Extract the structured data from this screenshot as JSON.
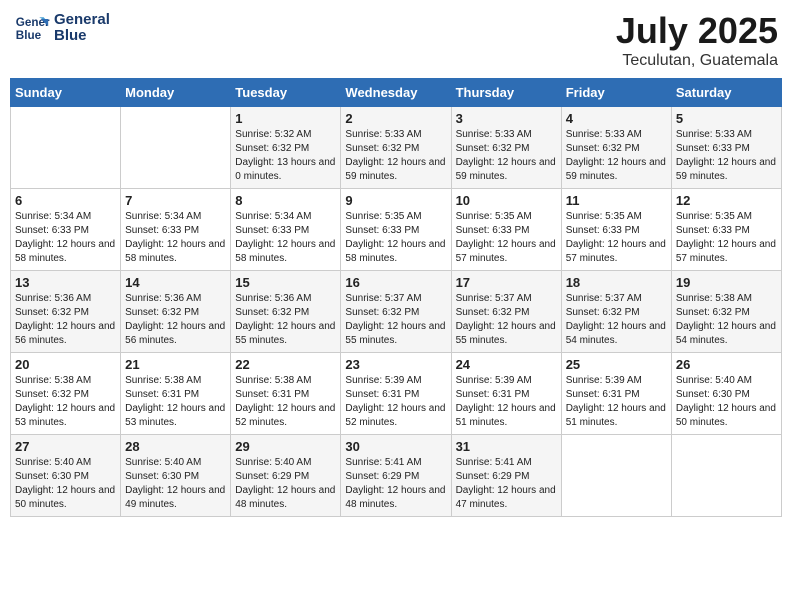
{
  "header": {
    "logo_line1": "General",
    "logo_line2": "Blue",
    "month": "July 2025",
    "location": "Teculutan, Guatemala"
  },
  "weekdays": [
    "Sunday",
    "Monday",
    "Tuesday",
    "Wednesday",
    "Thursday",
    "Friday",
    "Saturday"
  ],
  "weeks": [
    [
      {
        "day": null
      },
      {
        "day": null
      },
      {
        "day": 1,
        "sunrise": "5:32 AM",
        "sunset": "6:32 PM",
        "daylight": "13 hours and 0 minutes."
      },
      {
        "day": 2,
        "sunrise": "5:33 AM",
        "sunset": "6:32 PM",
        "daylight": "12 hours and 59 minutes."
      },
      {
        "day": 3,
        "sunrise": "5:33 AM",
        "sunset": "6:32 PM",
        "daylight": "12 hours and 59 minutes."
      },
      {
        "day": 4,
        "sunrise": "5:33 AM",
        "sunset": "6:32 PM",
        "daylight": "12 hours and 59 minutes."
      },
      {
        "day": 5,
        "sunrise": "5:33 AM",
        "sunset": "6:33 PM",
        "daylight": "12 hours and 59 minutes."
      }
    ],
    [
      {
        "day": 6,
        "sunrise": "5:34 AM",
        "sunset": "6:33 PM",
        "daylight": "12 hours and 58 minutes."
      },
      {
        "day": 7,
        "sunrise": "5:34 AM",
        "sunset": "6:33 PM",
        "daylight": "12 hours and 58 minutes."
      },
      {
        "day": 8,
        "sunrise": "5:34 AM",
        "sunset": "6:33 PM",
        "daylight": "12 hours and 58 minutes."
      },
      {
        "day": 9,
        "sunrise": "5:35 AM",
        "sunset": "6:33 PM",
        "daylight": "12 hours and 58 minutes."
      },
      {
        "day": 10,
        "sunrise": "5:35 AM",
        "sunset": "6:33 PM",
        "daylight": "12 hours and 57 minutes."
      },
      {
        "day": 11,
        "sunrise": "5:35 AM",
        "sunset": "6:33 PM",
        "daylight": "12 hours and 57 minutes."
      },
      {
        "day": 12,
        "sunrise": "5:35 AM",
        "sunset": "6:33 PM",
        "daylight": "12 hours and 57 minutes."
      }
    ],
    [
      {
        "day": 13,
        "sunrise": "5:36 AM",
        "sunset": "6:32 PM",
        "daylight": "12 hours and 56 minutes."
      },
      {
        "day": 14,
        "sunrise": "5:36 AM",
        "sunset": "6:32 PM",
        "daylight": "12 hours and 56 minutes."
      },
      {
        "day": 15,
        "sunrise": "5:36 AM",
        "sunset": "6:32 PM",
        "daylight": "12 hours and 55 minutes."
      },
      {
        "day": 16,
        "sunrise": "5:37 AM",
        "sunset": "6:32 PM",
        "daylight": "12 hours and 55 minutes."
      },
      {
        "day": 17,
        "sunrise": "5:37 AM",
        "sunset": "6:32 PM",
        "daylight": "12 hours and 55 minutes."
      },
      {
        "day": 18,
        "sunrise": "5:37 AM",
        "sunset": "6:32 PM",
        "daylight": "12 hours and 54 minutes."
      },
      {
        "day": 19,
        "sunrise": "5:38 AM",
        "sunset": "6:32 PM",
        "daylight": "12 hours and 54 minutes."
      }
    ],
    [
      {
        "day": 20,
        "sunrise": "5:38 AM",
        "sunset": "6:32 PM",
        "daylight": "12 hours and 53 minutes."
      },
      {
        "day": 21,
        "sunrise": "5:38 AM",
        "sunset": "6:31 PM",
        "daylight": "12 hours and 53 minutes."
      },
      {
        "day": 22,
        "sunrise": "5:38 AM",
        "sunset": "6:31 PM",
        "daylight": "12 hours and 52 minutes."
      },
      {
        "day": 23,
        "sunrise": "5:39 AM",
        "sunset": "6:31 PM",
        "daylight": "12 hours and 52 minutes."
      },
      {
        "day": 24,
        "sunrise": "5:39 AM",
        "sunset": "6:31 PM",
        "daylight": "12 hours and 51 minutes."
      },
      {
        "day": 25,
        "sunrise": "5:39 AM",
        "sunset": "6:31 PM",
        "daylight": "12 hours and 51 minutes."
      },
      {
        "day": 26,
        "sunrise": "5:40 AM",
        "sunset": "6:30 PM",
        "daylight": "12 hours and 50 minutes."
      }
    ],
    [
      {
        "day": 27,
        "sunrise": "5:40 AM",
        "sunset": "6:30 PM",
        "daylight": "12 hours and 50 minutes."
      },
      {
        "day": 28,
        "sunrise": "5:40 AM",
        "sunset": "6:30 PM",
        "daylight": "12 hours and 49 minutes."
      },
      {
        "day": 29,
        "sunrise": "5:40 AM",
        "sunset": "6:29 PM",
        "daylight": "12 hours and 48 minutes."
      },
      {
        "day": 30,
        "sunrise": "5:41 AM",
        "sunset": "6:29 PM",
        "daylight": "12 hours and 48 minutes."
      },
      {
        "day": 31,
        "sunrise": "5:41 AM",
        "sunset": "6:29 PM",
        "daylight": "12 hours and 47 minutes."
      },
      {
        "day": null
      },
      {
        "day": null
      }
    ]
  ]
}
